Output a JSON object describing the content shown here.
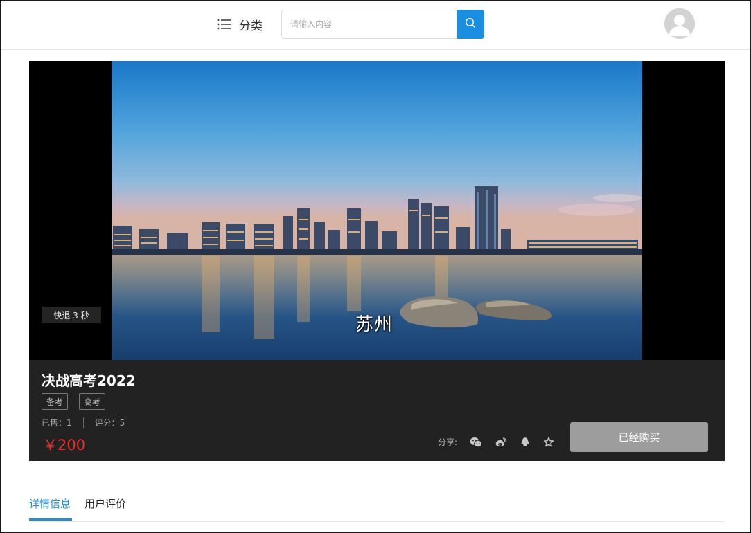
{
  "header": {
    "category_label": "分类",
    "search_placeholder": "请输入内容",
    "search_value": ""
  },
  "player": {
    "toast": "快退 3 秒",
    "subtitle": "苏州"
  },
  "course": {
    "title": "决战高考2022",
    "tags": [
      "备考",
      "高考"
    ],
    "sold_label": "已售：1",
    "rating_label": "评分：5",
    "price": "￥200",
    "share_label": "分享:",
    "buy_label": "已经购买"
  },
  "tabs": [
    {
      "label": "详情信息",
      "active": true
    },
    {
      "label": "用户评价",
      "active": false
    }
  ],
  "colors": {
    "accent": "#1a8ee0",
    "price": "#e23030",
    "disabled_button": "#9d9d9d",
    "info_bg": "#222222"
  },
  "icons": [
    "list-icon",
    "search-icon",
    "avatar-icon",
    "wechat-icon",
    "weibo-icon",
    "qq-icon",
    "star-icon"
  ]
}
